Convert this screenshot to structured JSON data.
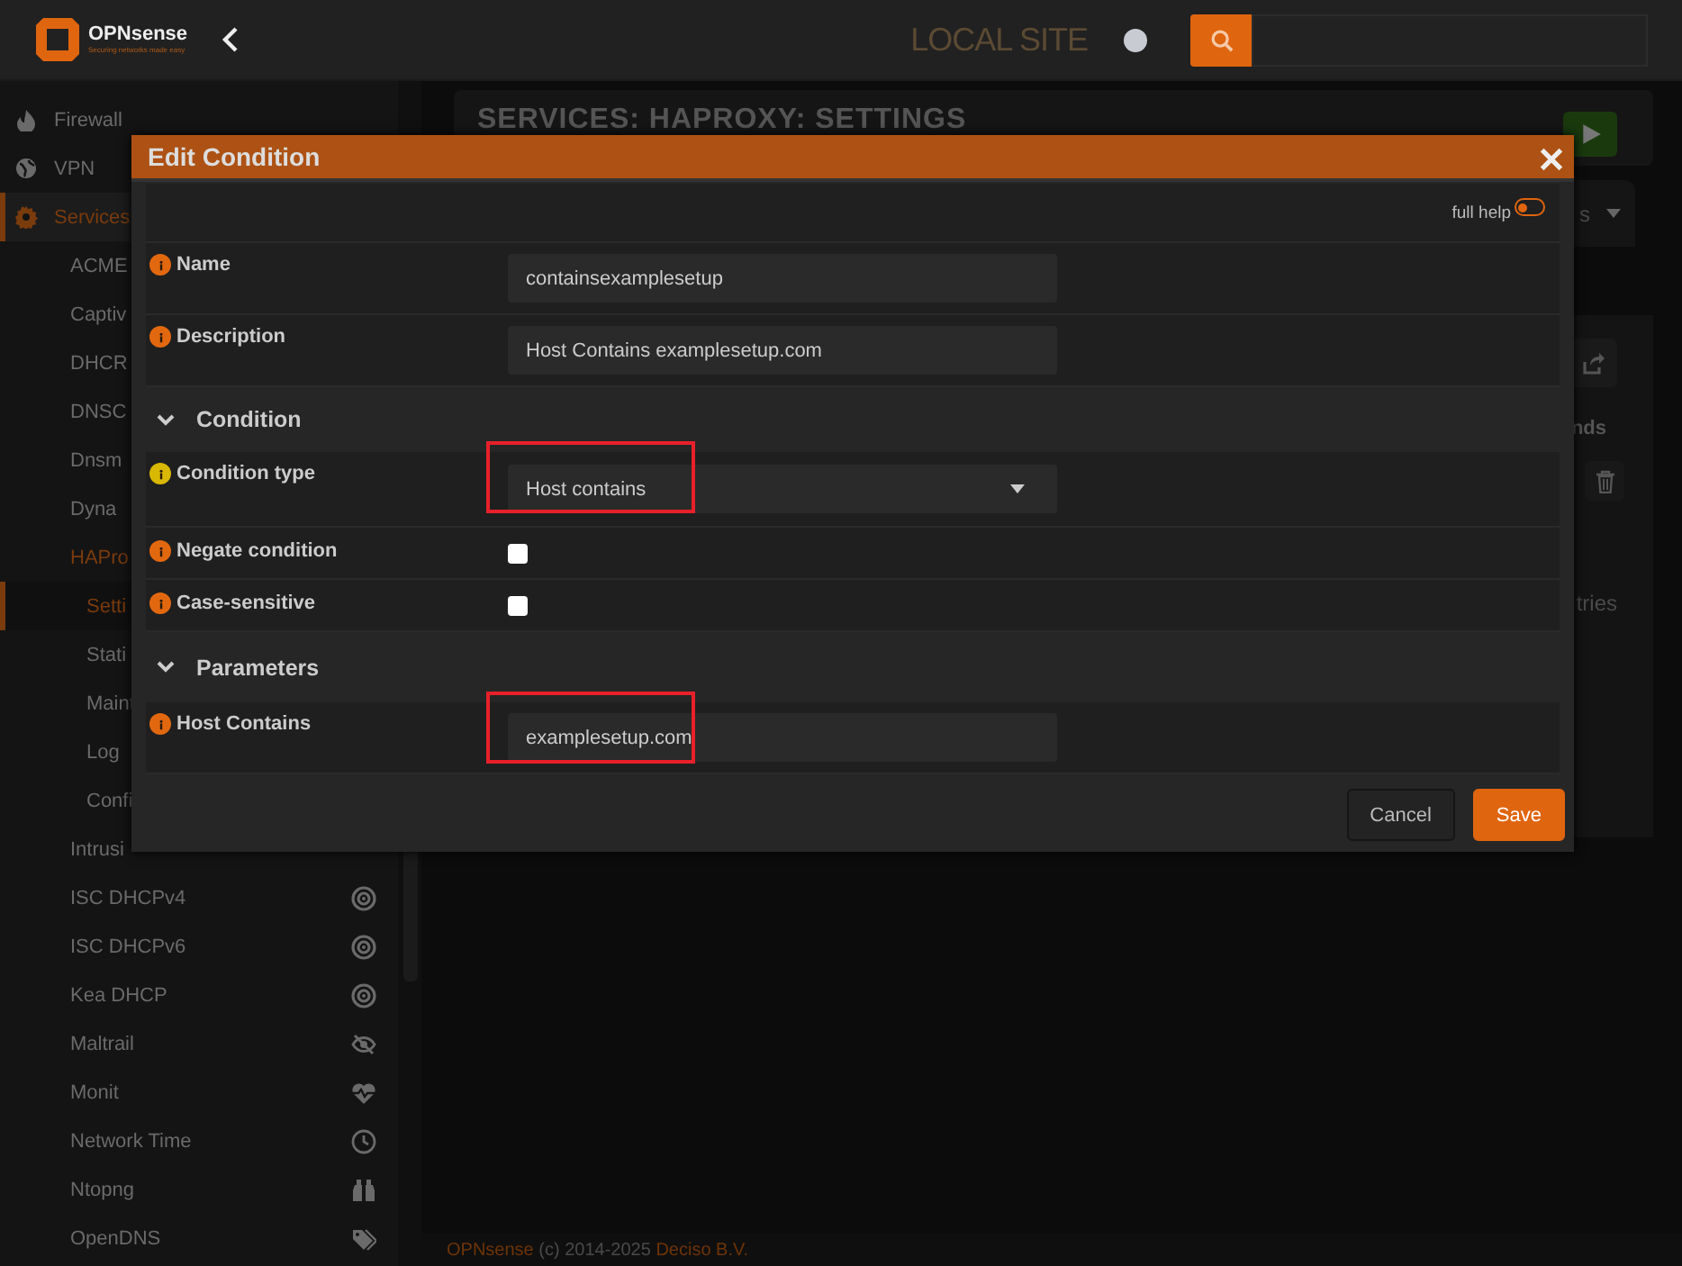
{
  "topbar": {
    "logo": {
      "name": "OPNsense",
      "tagline": "Securing networks made easy"
    },
    "site_label": "LOCAL SITE"
  },
  "sidebar": {
    "items": [
      {
        "label": "Firewall",
        "selected": false
      },
      {
        "label": "VPN",
        "selected": false
      },
      {
        "label": "Services",
        "selected": false,
        "children": [
          {
            "label": "ACME",
            "selected": false
          },
          {
            "label": "Captiv",
            "selected": false
          },
          {
            "label": "DHCR",
            "selected": false
          },
          {
            "label": "DNSC",
            "selected": false
          },
          {
            "label": "Dnsm",
            "selected": false
          },
          {
            "label": "Dyna",
            "selected": false
          },
          {
            "label": "HAPro",
            "selected": false,
            "children": [
              {
                "label": "Setti",
                "selected": true
              },
              {
                "label": "Stati",
                "selected": false
              },
              {
                "label": "Maint",
                "selected": false
              },
              {
                "label": "Log",
                "selected": false
              },
              {
                "label": "Confi",
                "selected": false
              }
            ]
          },
          {
            "label": "Intrusi",
            "selected": false
          },
          {
            "label": "ISC DHCPv4",
            "selected": false
          },
          {
            "label": "ISC DHCPv6",
            "selected": false
          },
          {
            "label": "Kea DHCP",
            "selected": false
          },
          {
            "label": "Maltrail",
            "selected": false
          },
          {
            "label": "Monit",
            "selected": false
          },
          {
            "label": "Network Time",
            "selected": false
          },
          {
            "label": "Ntopng",
            "selected": false
          },
          {
            "label": "OpenDNS",
            "selected": false
          }
        ]
      }
    ]
  },
  "page": {
    "title": "SERVICES: HAPROXY: SETTINGS",
    "tab_fragment": "s",
    "column_fragment": "nds",
    "info_fragment": "tries"
  },
  "footer": {
    "parts": [
      {
        "kind": "link",
        "text": "OPNsense"
      },
      {
        "kind": "plain",
        "text": "(c) 2014-2025"
      },
      {
        "kind": "link",
        "text": "Deciso B.V."
      }
    ]
  },
  "modal": {
    "title": "Edit Condition",
    "full_help": {
      "label": "full help",
      "on": false
    },
    "rows": [
      {
        "kind": "text",
        "label": "Name",
        "value": "containsexamplesetup",
        "color": "#e2680f",
        "highlighted": false
      },
      {
        "kind": "text",
        "label": "Description",
        "value": "Host Contains examplesetup.com",
        "color": "#e2680f",
        "highlighted": false
      },
      {
        "kind": "section",
        "label": "Condition",
        "expanded": true
      },
      {
        "kind": "select",
        "label": "Condition type",
        "value": "Host contains",
        "color": "#d8b800",
        "highlighted": true
      },
      {
        "kind": "checkbox",
        "label": "Negate condition",
        "checked": false,
        "color": "#e2680f"
      },
      {
        "kind": "checkbox",
        "label": "Case-sensitive",
        "checked": false,
        "color": "#e2680f"
      },
      {
        "kind": "section",
        "label": "Parameters",
        "expanded": true
      },
      {
        "kind": "text",
        "label": "Host Contains",
        "value": "examplesetup.com",
        "color": "#e2680f",
        "highlighted": true
      }
    ],
    "buttons": [
      {
        "kind": "secondary",
        "label": "Cancel"
      },
      {
        "kind": "primary",
        "label": "Save"
      }
    ]
  }
}
